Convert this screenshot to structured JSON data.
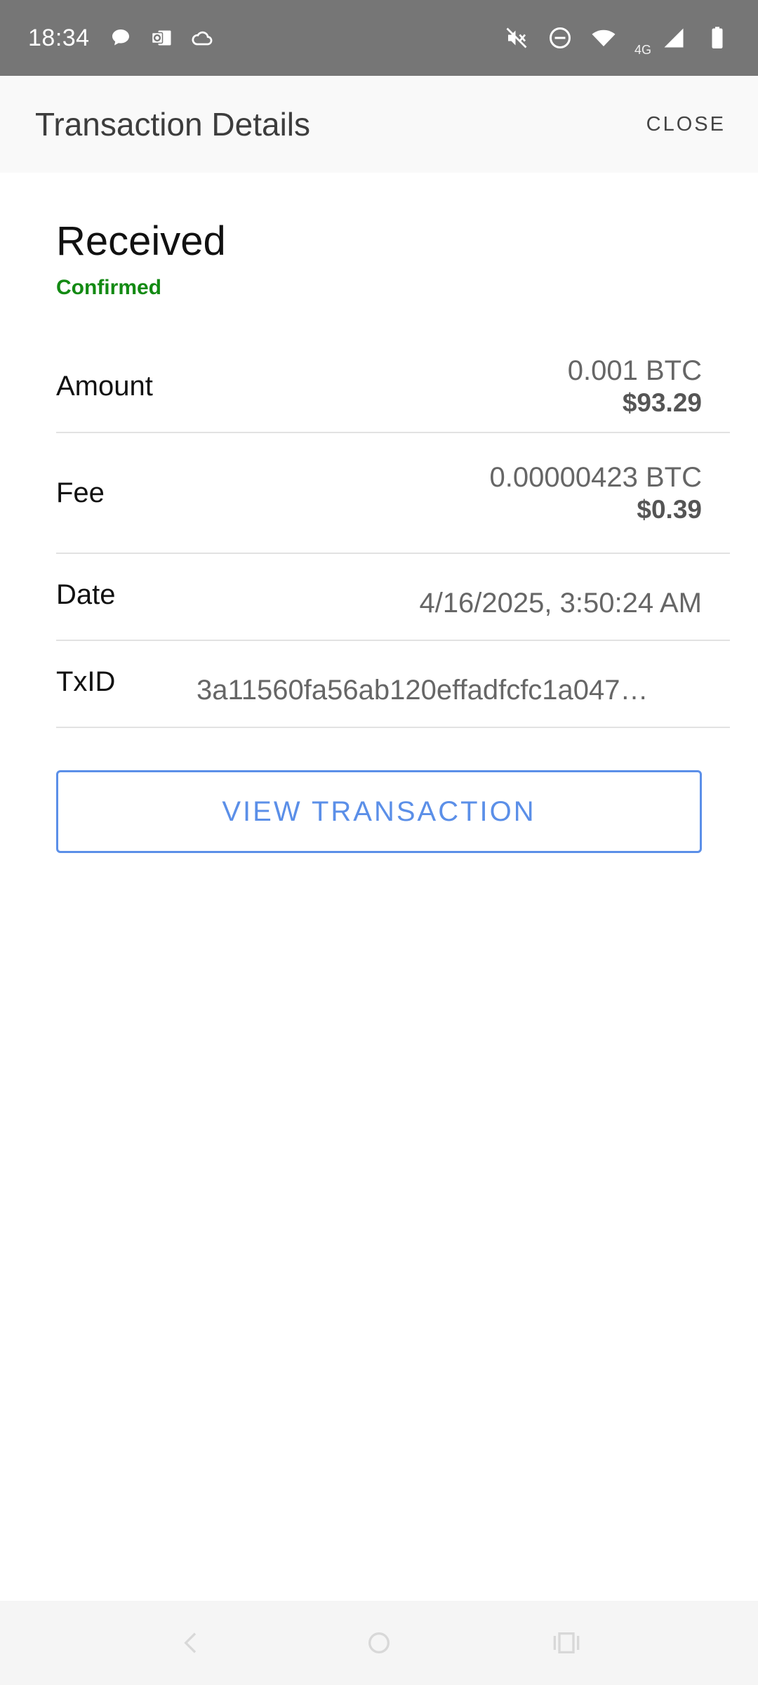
{
  "status_bar": {
    "time": "18:34",
    "network_label": "4G",
    "left_icons": [
      "chat-bubble-icon",
      "outlook-icon",
      "cloud-icon"
    ],
    "right_icons": [
      "vibrate-off-icon",
      "do-not-disturb-icon",
      "wifi-icon",
      "signal-icon",
      "battery-icon"
    ]
  },
  "app_bar": {
    "title": "Transaction Details",
    "close_label": "CLOSE"
  },
  "transaction": {
    "type": "Received",
    "status": "Confirmed",
    "status_color": "#138a13",
    "rows": {
      "amount": {
        "label": "Amount",
        "btc": "0.001 BTC",
        "usd": "$93.29"
      },
      "fee": {
        "label": "Fee",
        "btc": "0.00000423 BTC",
        "usd": "$0.39"
      },
      "date": {
        "label": "Date",
        "value": "4/16/2025, 3:50:24 AM"
      },
      "txid": {
        "label": "TxID",
        "value": "3a11560fa56ab120effadfcfc1a047…"
      }
    }
  },
  "actions": {
    "view_transaction_label": "VIEW TRANSACTION",
    "accent_color": "#5b8fe8"
  },
  "nav_bar": {
    "buttons": [
      "back-icon",
      "home-icon",
      "recents-icon"
    ]
  }
}
